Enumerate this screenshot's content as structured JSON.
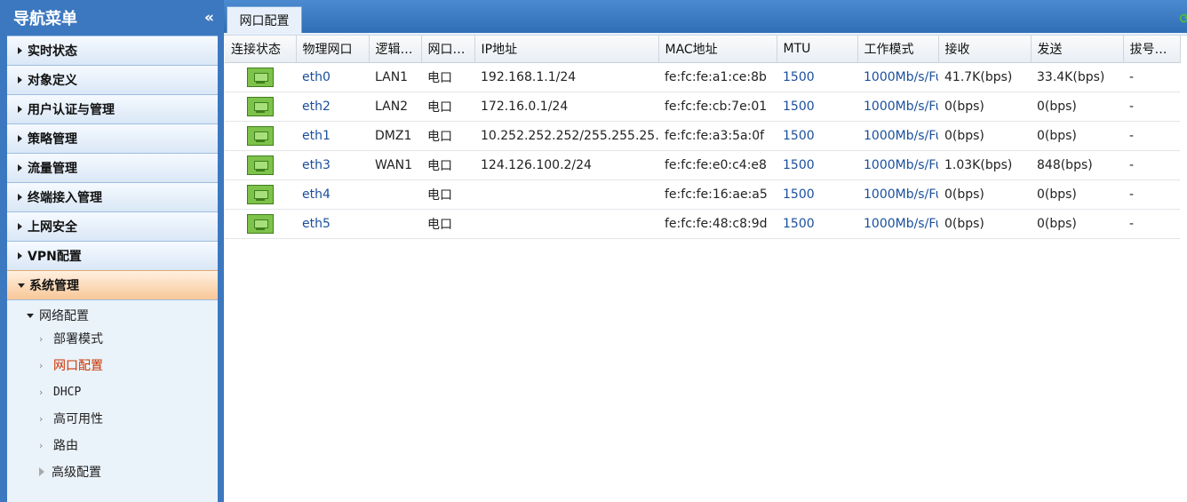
{
  "sidebar": {
    "title": "导航菜单",
    "collapse_icon": "«",
    "items": [
      {
        "label": "实时状态"
      },
      {
        "label": "对象定义"
      },
      {
        "label": "用户认证与管理"
      },
      {
        "label": "策略管理"
      },
      {
        "label": "流量管理"
      },
      {
        "label": "终端接入管理"
      },
      {
        "label": "上网安全"
      },
      {
        "label": "VPN配置"
      },
      {
        "label": "系统管理"
      }
    ],
    "submenu": {
      "group_label": "网络配置",
      "items": [
        {
          "label": "部署模式"
        },
        {
          "label": "网口配置"
        },
        {
          "label": "DHCP"
        },
        {
          "label": "高可用性"
        },
        {
          "label": "路由"
        },
        {
          "label": "高级配置"
        }
      ]
    }
  },
  "tab": {
    "label": "网口配置"
  },
  "table": {
    "headers": [
      "连接状态",
      "物理网口",
      "逻辑…",
      "网口…",
      "IP地址",
      "MAC地址",
      "MTU",
      "工作模式",
      "接收",
      "发送",
      "拔号…"
    ],
    "rows": [
      {
        "port": "eth0",
        "logic": "LAN1",
        "type": "电口",
        "ip": "192.168.1.1/24",
        "mac": "fe:fc:fe:a1:ce:8b",
        "mtu": "1500",
        "mode": "1000Mb/s/Fu",
        "rx": "41.7K(bps)",
        "tx": "33.4K(bps)",
        "dial": "-"
      },
      {
        "port": "eth2",
        "logic": "LAN2",
        "type": "电口",
        "ip": "172.16.0.1/24",
        "mac": "fe:fc:fe:cb:7e:01",
        "mtu": "1500",
        "mode": "1000Mb/s/Fu",
        "rx": "0(bps)",
        "tx": "0(bps)",
        "dial": "-"
      },
      {
        "port": "eth1",
        "logic": "DMZ1",
        "type": "电口",
        "ip": "10.252.252.252/255.255.25…",
        "mac": "fe:fc:fe:a3:5a:0f",
        "mtu": "1500",
        "mode": "1000Mb/s/Fu",
        "rx": "0(bps)",
        "tx": "0(bps)",
        "dial": "-"
      },
      {
        "port": "eth3",
        "logic": "WAN1",
        "type": "电口",
        "ip": "124.126.100.2/24",
        "mac": "fe:fc:fe:e0:c4:e8",
        "mtu": "1500",
        "mode": "1000Mb/s/Fu",
        "rx": "1.03K(bps)",
        "tx": "848(bps)",
        "dial": "-"
      },
      {
        "port": "eth4",
        "logic": "",
        "type": "电口",
        "ip": "",
        "mac": "fe:fc:fe:16:ae:a5",
        "mtu": "1500",
        "mode": "1000Mb/s/Fu",
        "rx": "0(bps)",
        "tx": "0(bps)",
        "dial": "-"
      },
      {
        "port": "eth5",
        "logic": "",
        "type": "电口",
        "ip": "",
        "mac": "fe:fc:fe:48:c8:9d",
        "mtu": "1500",
        "mode": "1000Mb/s/Fu",
        "rx": "0(bps)",
        "tx": "0(bps)",
        "dial": "-"
      }
    ]
  }
}
